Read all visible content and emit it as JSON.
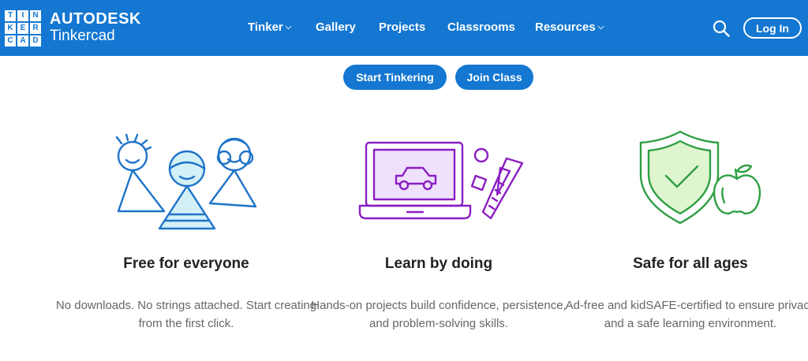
{
  "header": {
    "logo_letters": [
      "T",
      "I",
      "N",
      "K",
      "E",
      "R",
      "C",
      "A",
      "D"
    ],
    "brand_top": "AUTODESK",
    "brand_bottom": "Tinkercad",
    "nav": [
      {
        "label": "Tinker",
        "has_dropdown": true
      },
      {
        "label": "Gallery",
        "has_dropdown": false
      },
      {
        "label": "Projects",
        "has_dropdown": false
      },
      {
        "label": "Classrooms",
        "has_dropdown": false
      },
      {
        "label": "Resources",
        "has_dropdown": true
      }
    ],
    "search_icon": "search-icon",
    "login_label": "Log In"
  },
  "cta": {
    "start_label": "Start Tinkering",
    "join_label": "Join Class"
  },
  "features": [
    {
      "icon": "kids-group-illustration",
      "title": "Free for everyone",
      "description": "No downloads. No strings attached. Start creating from the first click."
    },
    {
      "icon": "laptop-car-illustration",
      "title": "Learn by doing",
      "description": "Hands-on projects build confidence, persistence, and problem-solving skills."
    },
    {
      "icon": "shield-apple-illustration",
      "title": "Safe for all ages",
      "description": "Ad-free and kidSAFE-certified to ensure privacy and a safe learning environment."
    }
  ],
  "colors": {
    "brand_blue": "#1477d1",
    "kids_blue": "#1f73c9",
    "laptop_purple": "#8a1ec2",
    "laptop_fill": "#efe0fb",
    "shield_green": "#2ea043",
    "shield_fill": "#dff5cf"
  }
}
